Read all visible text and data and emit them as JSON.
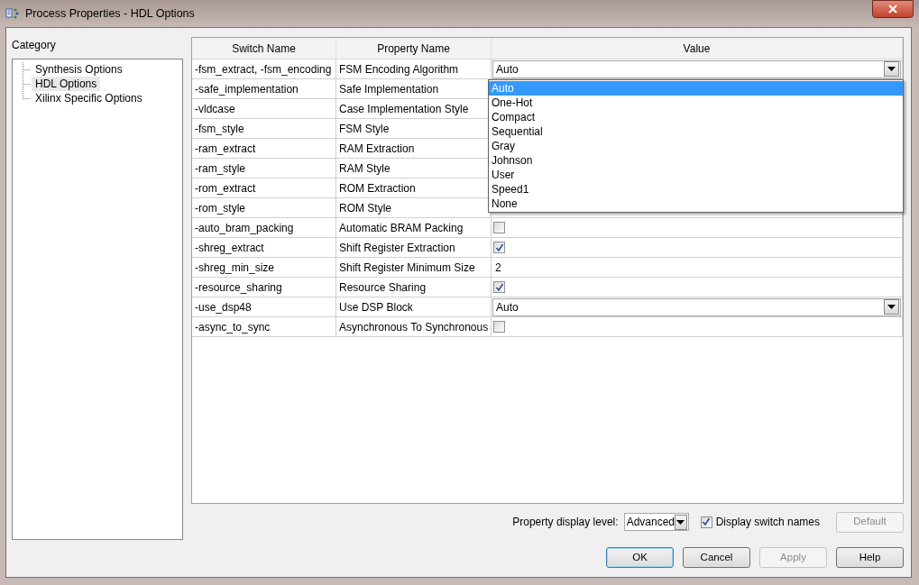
{
  "window": {
    "title": "Process Properties - HDL Options"
  },
  "category": {
    "label": "Category",
    "items": [
      {
        "label": "Synthesis Options",
        "selected": false
      },
      {
        "label": "HDL Options",
        "selected": true
      },
      {
        "label": "Xilinx Specific Options",
        "selected": false
      }
    ]
  },
  "table": {
    "columns": [
      "Switch Name",
      "Property Name",
      "Value"
    ],
    "rows": [
      {
        "switch": "-fsm_extract, -fsm_encoding",
        "property": "FSM Encoding Algorithm",
        "value": {
          "kind": "combo",
          "text": "Auto",
          "options": [
            {
              "label": "Auto",
              "selected": true
            },
            {
              "label": "One-Hot",
              "selected": false
            },
            {
              "label": "Compact",
              "selected": false
            },
            {
              "label": "Sequential",
              "selected": false
            },
            {
              "label": "Gray",
              "selected": false
            },
            {
              "label": "Johnson",
              "selected": false
            },
            {
              "label": "User",
              "selected": false
            },
            {
              "label": "Speed1",
              "selected": false
            },
            {
              "label": "None",
              "selected": false
            }
          ]
        }
      },
      {
        "switch": "-safe_implementation",
        "property": "Safe Implementation"
      },
      {
        "switch": "-vldcase",
        "property": "Case Implementation Style"
      },
      {
        "switch": "-fsm_style",
        "property": "FSM Style"
      },
      {
        "switch": "-ram_extract",
        "property": "RAM Extraction"
      },
      {
        "switch": "-ram_style",
        "property": "RAM Style"
      },
      {
        "switch": "-rom_extract",
        "property": "ROM Extraction"
      },
      {
        "switch": "-rom_style",
        "property": "ROM Style"
      },
      {
        "switch": "-auto_bram_packing",
        "property": "Automatic BRAM Packing",
        "value": {
          "kind": "checkbox",
          "checked": false
        }
      },
      {
        "switch": "-shreg_extract",
        "property": "Shift Register Extraction",
        "value": {
          "kind": "checkbox",
          "checked": true
        }
      },
      {
        "switch": "-shreg_min_size",
        "property": "Shift Register Minimum Size",
        "value": {
          "kind": "text",
          "text": "2"
        }
      },
      {
        "switch": "-resource_sharing",
        "property": "Resource Sharing",
        "value": {
          "kind": "checkbox",
          "checked": true
        }
      },
      {
        "switch": "-use_dsp48",
        "property": "Use DSP Block",
        "value": {
          "kind": "combo",
          "text": "Auto"
        }
      },
      {
        "switch": "-async_to_sync",
        "property": "Asynchronous To Synchronous",
        "value": {
          "kind": "checkbox",
          "checked": false
        }
      }
    ]
  },
  "footer": {
    "level_label": "Property display level:",
    "level_value": "Advanced",
    "switch_names": {
      "label": "Display switch names",
      "checked": true
    },
    "default_button": {
      "label": "Default",
      "disabled": true
    }
  },
  "buttons": [
    {
      "label": "OK",
      "disabled": false,
      "default": true
    },
    {
      "label": "Cancel",
      "disabled": false,
      "default": false
    },
    {
      "label": "Apply",
      "disabled": true,
      "default": false
    },
    {
      "label": "Help",
      "disabled": false,
      "default": false
    }
  ]
}
